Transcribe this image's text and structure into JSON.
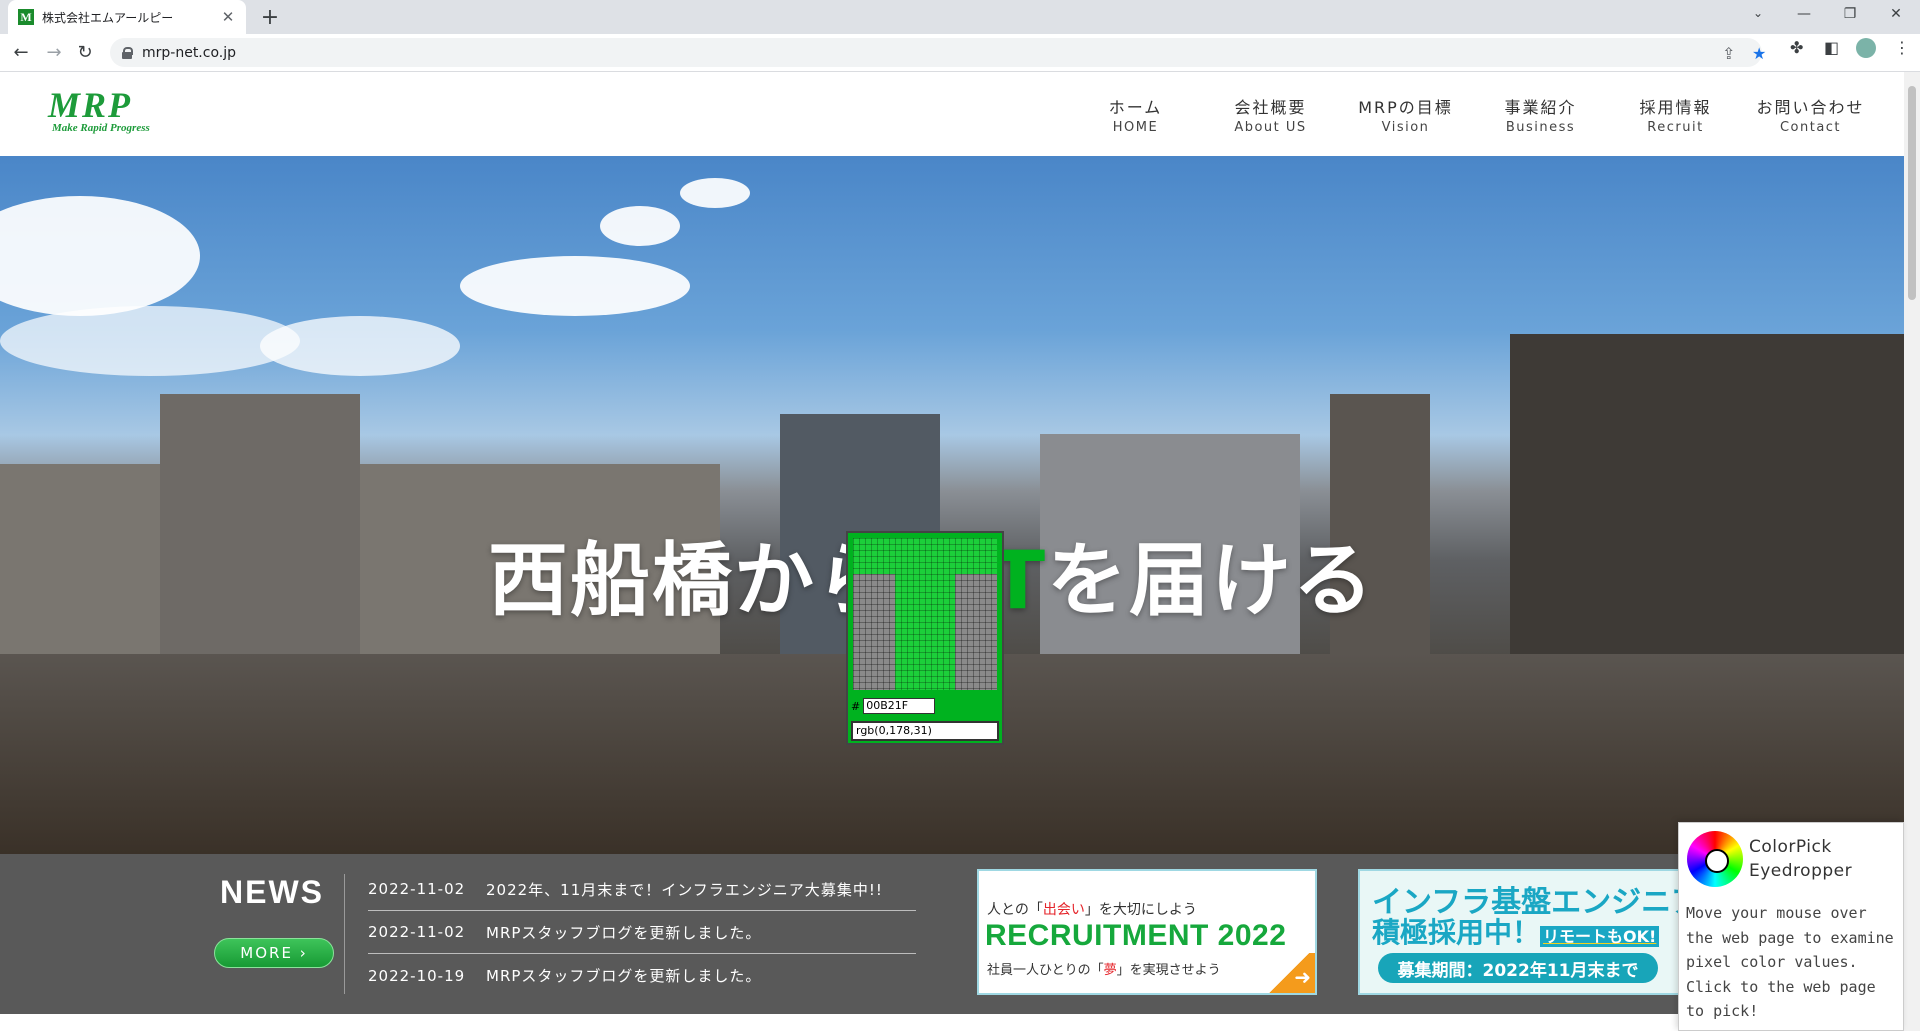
{
  "browser": {
    "tab_title": "株式会社エムアールピー",
    "favicon_letter": "M",
    "url": "mrp-net.co.jp"
  },
  "site": {
    "logo": {
      "main": "MRP",
      "sub": "Make Rapid Progress"
    },
    "nav": [
      {
        "jp": "ホーム",
        "en": "HOME"
      },
      {
        "jp": "会社概要",
        "en": "About US"
      },
      {
        "jp": "MRPの目標",
        "en": "Vision"
      },
      {
        "jp": "事業紹介",
        "en": "Business"
      },
      {
        "jp": "採用情報",
        "en": "Recruit"
      },
      {
        "jp": "お問い合わせ",
        "en": "Contact"
      }
    ],
    "hero": {
      "before": "西船橋から",
      "accent": "ICT",
      "after": "を届ける",
      "accent_color": "#00b21f"
    },
    "news": {
      "title": "NEWS",
      "more_label": "MORE",
      "items": [
        {
          "date": "2022-11-02",
          "text": "2022年、11月末まで！インフラエンジニア大募集中!!"
        },
        {
          "date": "2022-11-02",
          "text": "MRPスタッフブログを更新しました。"
        },
        {
          "date": "2022-10-19",
          "text": "MRPスタッフブログを更新しました。"
        }
      ]
    },
    "banner_recruit": {
      "top_pre": "人との「",
      "top_em": "出会い",
      "top_post": "」を大切にしよう",
      "main": "RECRUITMENT 2022",
      "bottom_pre": "社員一人ひとりの「",
      "bottom_em": "夢",
      "bottom_post": "」を実現させよう"
    },
    "banner_infra": {
      "line1": "インフラ基盤エンジニア",
      "line2": "積極採用中！",
      "line2_small": "リモートもOK!",
      "pill": "募集期間：2022年11月末まで"
    }
  },
  "colorpick": {
    "hex_label": "#",
    "hex": "00B21F",
    "rgb": "rgb(0,178,31)",
    "title_line1": "ColorPick",
    "title_line2": "Eyedropper",
    "description": "Move your mouse over the web page to examine pixel color values. Click to the web page to pick!"
  },
  "colors": {
    "brand_green": "#1d9b3a",
    "news_bg": "#595959",
    "picked": "#00b21f"
  }
}
